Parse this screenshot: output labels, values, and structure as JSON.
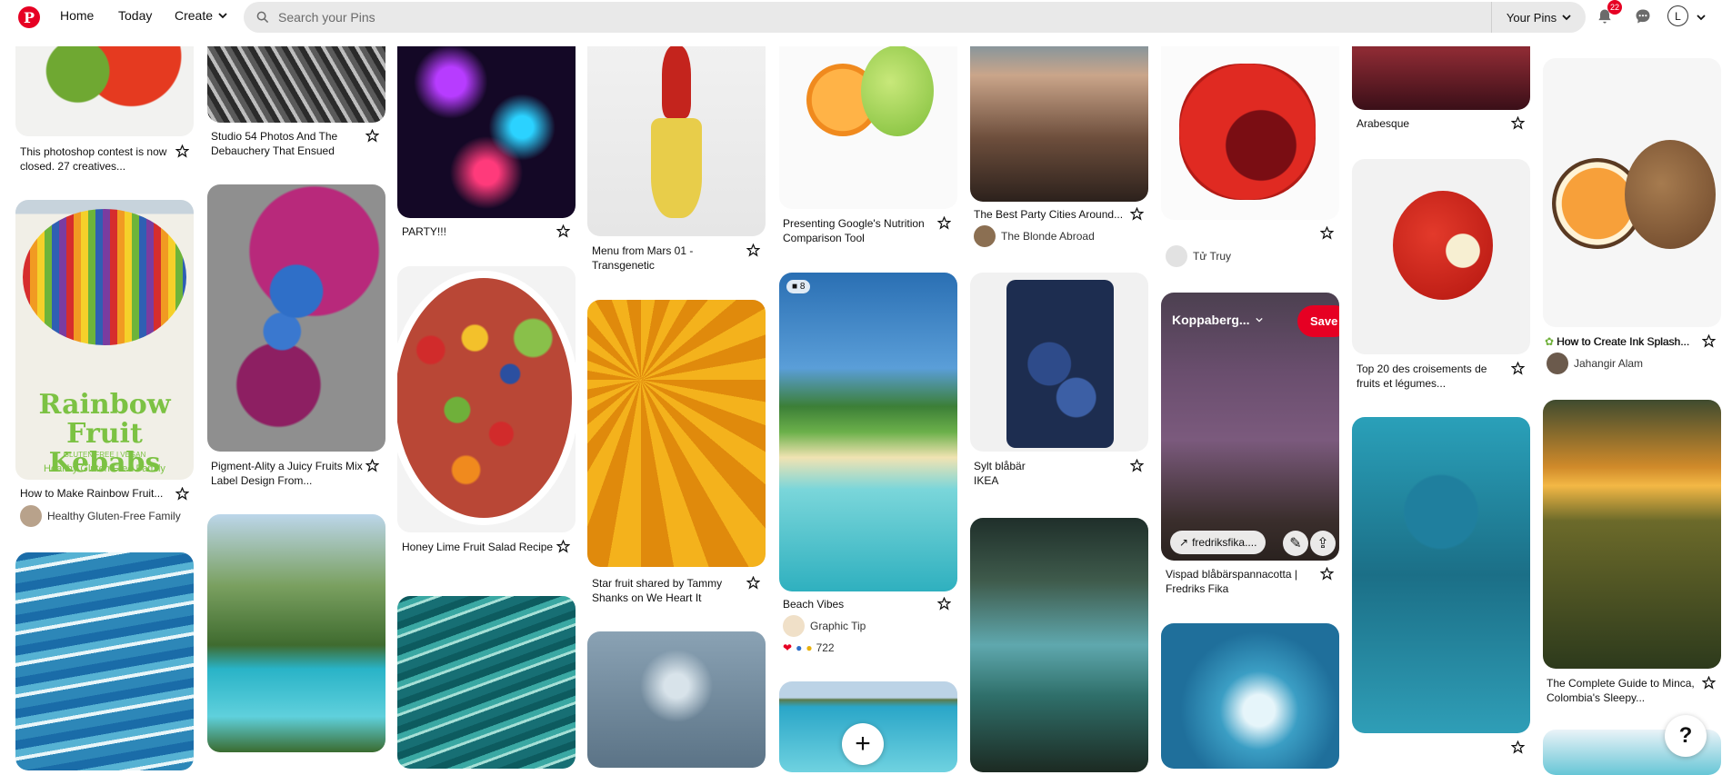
{
  "header": {
    "logo": "P",
    "nav": [
      "Home",
      "Today",
      "Create"
    ],
    "search_placeholder": "Search your Pins",
    "your_pins": "Your Pins",
    "notifications_count": "22",
    "avatar_initial": "L"
  },
  "pins": {
    "p1": {
      "title": "This photoshop contest is now closed. 27 creatives..."
    },
    "p2": {
      "title": "How to Make Rainbow Fruit...",
      "author": "Healthy Gluten-Free Family",
      "overlay_title": "Rainbow Fruit Kebabs",
      "overlay_sub": "GLUTEN FREE | VEGAN",
      "overlay_brand": "Healthy Gluten Free Family"
    },
    "p4": {
      "title": "Studio 54 Photos And The Debauchery That Ensued"
    },
    "p5": {
      "title": "Pigment-Ality a Juicy Fruits Mix Label Design From..."
    },
    "p7": {
      "title": "PARTY!!!"
    },
    "p8": {
      "title": "Honey Lime Fruit Salad Recipe"
    },
    "p10": {
      "title": "Menu from Mars 01 - Transgenetic"
    },
    "p11": {
      "title": "Star fruit shared by Tammy Shanks on We Heart It"
    },
    "p13": {
      "title": "Presenting Google's Nutrition Comparison Tool"
    },
    "p14": {
      "title": "Beach Vibes",
      "author": "Graphic Tip",
      "count": "8",
      "reactions": "722"
    },
    "p16": {
      "title": "The Best Party Cities Around...",
      "author": "The Blonde Abroad"
    },
    "p17": {
      "title": "Sylt blåbär",
      "subtitle": "IKEA"
    },
    "p19": {
      "author": "Tử Truy"
    },
    "p20": {
      "title": "Vispad blåbärspannacotta | Fredriks Fika",
      "board": "Koppaberg...",
      "save": "Save",
      "link": "fredriksfika...."
    },
    "p22": {
      "title": "Arabesque"
    },
    "p23": {
      "title": "Top 20 des croisements de fruits et légumes..."
    },
    "p25": {
      "title": "How to Create Ink Splash...",
      "author": "Jahangir Alam"
    },
    "p26": {
      "title": "The Complete Guide to Minca, Colombia's Sleepy..."
    }
  },
  "help": "?",
  "plus": "+"
}
